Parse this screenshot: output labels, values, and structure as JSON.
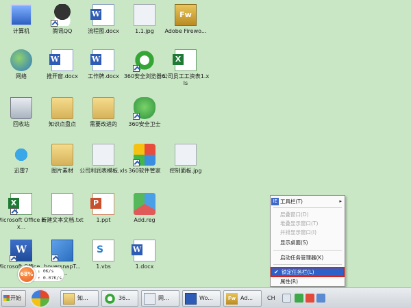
{
  "desktop_icons": [
    {
      "label": "计算机",
      "icon": "computer-icon"
    },
    {
      "label": "腾讯QQ",
      "icon": "qq-icon"
    },
    {
      "label": "流程图.docx",
      "icon": "word-doc-icon"
    },
    {
      "label": "1.1.jpg",
      "icon": "image-file-icon"
    },
    {
      "label": "Adobe Firewo...",
      "icon": "fireworks-icon"
    },
    {
      "label": "网络",
      "icon": "network-icon"
    },
    {
      "label": "推开窗.docx",
      "icon": "word-doc-icon"
    },
    {
      "label": "工作牌.docx",
      "icon": "word-doc-icon"
    },
    {
      "label": "360安全浏览器6",
      "icon": "360-browser-icon"
    },
    {
      "label": "公司员工工资表1.xls",
      "icon": "excel-file-icon"
    },
    {
      "label": "回收站",
      "icon": "recycle-bin-icon"
    },
    {
      "label": "知识点盘点",
      "icon": "folder-icon"
    },
    {
      "label": "需要改进的",
      "icon": "folder-icon"
    },
    {
      "label": "360安全卫士",
      "icon": "360-security-icon"
    },
    {
      "label": "迅雷7",
      "icon": "xunlei-icon"
    },
    {
      "label": "图片素材",
      "icon": "folder-icon"
    },
    {
      "label": "公司利润表模板.xls",
      "icon": "excel-template-icon"
    },
    {
      "label": "360软件管家",
      "icon": "360-software-icon"
    },
    {
      "label": "控制面板.jpg",
      "icon": "image-file-icon"
    },
    {
      "label": "Microsoft Office Ex...",
      "icon": "excel-app-icon"
    },
    {
      "label": "新建文本文档.txt",
      "icon": "text-file-icon"
    },
    {
      "label": "1.ppt",
      "icon": "ppt-file-icon"
    },
    {
      "label": "Add.reg",
      "icon": "registry-file-icon"
    },
    {
      "label": "Microsoft Office...",
      "icon": "word-app-icon"
    },
    {
      "label": "hoversnapT... 文...",
      "icon": "hoversnap-icon"
    },
    {
      "label": "1.vbs",
      "icon": "vbs-file-icon"
    },
    {
      "label": "1.docx",
      "icon": "word-doc-icon"
    }
  ],
  "speed_widget": {
    "percent": "68%",
    "download": "0K/s",
    "upload": "0.07K/s",
    "download_marker": "↓",
    "upload_marker": "↑"
  },
  "context_menu": {
    "toolbar_icon_text": "IE",
    "items": [
      {
        "label": "工具栏(T)",
        "disabled": false,
        "submenu": true
      },
      {
        "label": "层叠窗口(D)",
        "disabled": true
      },
      {
        "label": "堆叠显示窗口(T)",
        "disabled": true
      },
      {
        "label": "并排显示窗口(I)",
        "disabled": true
      },
      {
        "label": "显示桌面(S)",
        "disabled": false
      },
      {
        "label": "启动任务管理器(K)",
        "disabled": false
      },
      {
        "label": "锁定任务栏(L)",
        "disabled": false,
        "checked": true,
        "highlighted": true
      },
      {
        "label": "属性(R)",
        "disabled": false
      }
    ],
    "submenu_arrow": "▸",
    "check_mark": "✔"
  },
  "taskbar": {
    "start_label": "开始",
    "buttons": [
      {
        "label": "知...",
        "icon": "folder-icon"
      },
      {
        "label": "36...",
        "icon": "360-browser-icon"
      },
      {
        "label": "网...",
        "icon": "image-viewer-icon"
      },
      {
        "label": "Wo...",
        "icon": "word-icon"
      },
      {
        "label": "Ad...",
        "icon": "fireworks-icon",
        "icon_text": "Fw"
      }
    ],
    "tray": {
      "language": "CH"
    }
  },
  "colors": {
    "desktop_bg": "#c9e7c5",
    "menu_highlight": "#2d60c8",
    "highlight_border": "#d4231c"
  }
}
